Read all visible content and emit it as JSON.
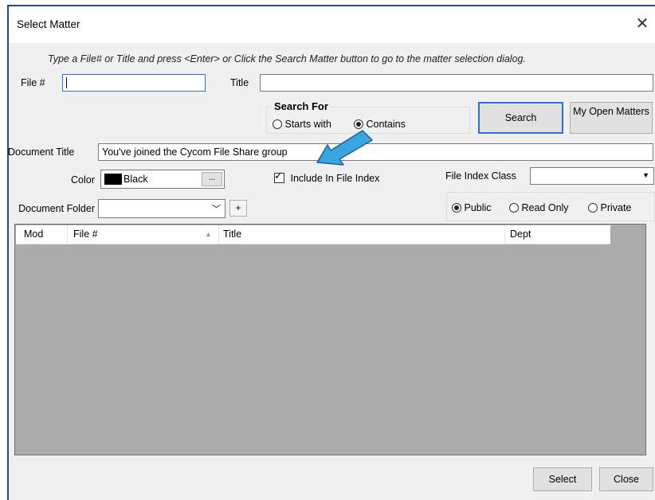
{
  "window": {
    "title": "Select Matter"
  },
  "hint": "Type a File# or Title and press <Enter> or Click the Search Matter button to go to the matter selection dialog.",
  "file_no": {
    "label": "File #",
    "value": ""
  },
  "title_field": {
    "label": "Title",
    "value": ""
  },
  "search_for": {
    "legend": "Search For",
    "options": [
      "Starts with",
      "Contains"
    ],
    "selected": "Contains"
  },
  "buttons": {
    "search": "Search",
    "my_open_matters": "My Open Matters",
    "select": "Select",
    "close": "Close"
  },
  "document_title": {
    "label": "Document Title",
    "value": "You've joined the Cycom File Share group"
  },
  "color": {
    "label": "Color",
    "value": "Black",
    "swatch": "#000000",
    "more": "..."
  },
  "include_in_index": {
    "label": "Include In File Index",
    "checked": true
  },
  "file_index_class": {
    "label": "File Index Class",
    "value": ""
  },
  "document_folder": {
    "label": "Document Folder",
    "value": "",
    "add": "+"
  },
  "access": {
    "options": [
      "Public",
      "Read Only",
      "Private"
    ],
    "selected": "Public"
  },
  "table": {
    "columns": [
      "Mod",
      "File #",
      "Title",
      "Dept"
    ],
    "rows": []
  },
  "annotation": {
    "arrow_color": "#3aa6e0"
  }
}
